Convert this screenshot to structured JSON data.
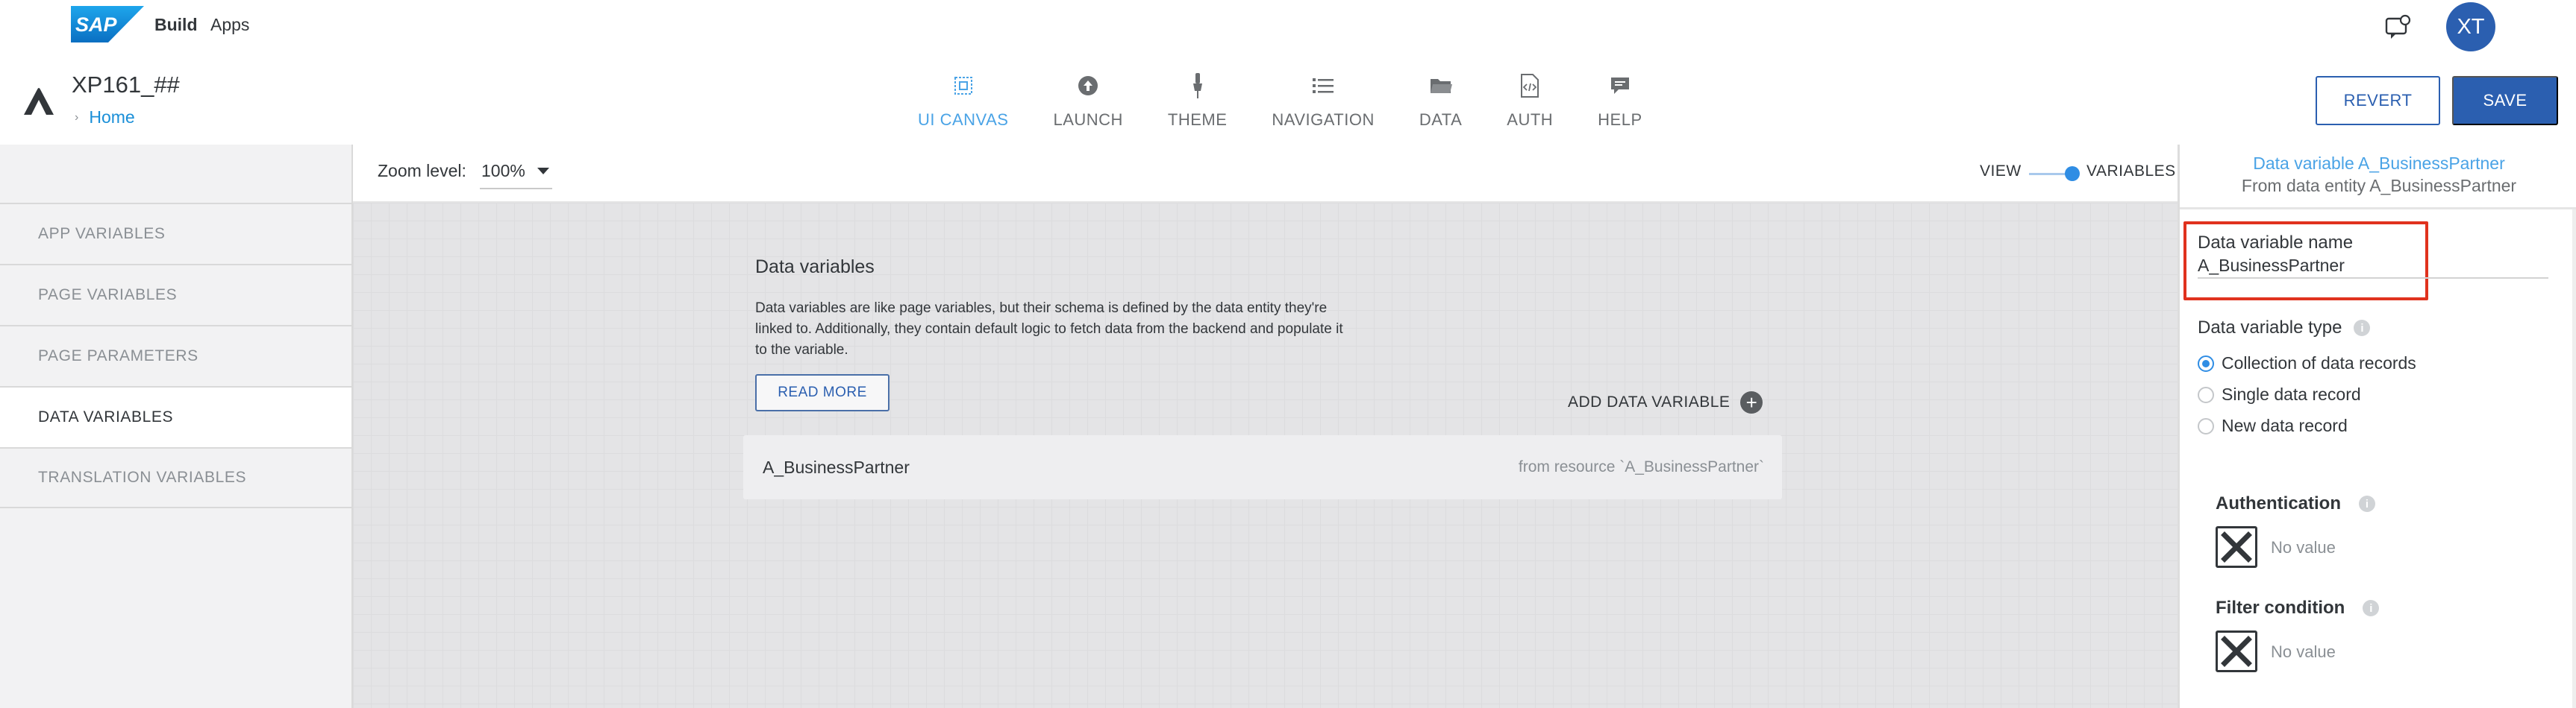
{
  "shell": {
    "logo": "SAP",
    "product_bold": "Build",
    "product_suffix": "Apps",
    "avatar_initials": "XT",
    "feedback_icon": "feedback-icon"
  },
  "app": {
    "title": "XP161_##",
    "breadcrumb": "Home"
  },
  "nav": {
    "tabs": [
      {
        "label": "UI CANVAS",
        "icon": "canvas-icon",
        "active": true
      },
      {
        "label": "LAUNCH",
        "icon": "upload-icon",
        "active": false
      },
      {
        "label": "THEME",
        "icon": "brush-icon",
        "active": false
      },
      {
        "label": "NAVIGATION",
        "icon": "list-icon",
        "active": false
      },
      {
        "label": "DATA",
        "icon": "folder-icon",
        "active": false
      },
      {
        "label": "AUTH",
        "icon": "code-file-icon",
        "active": false
      },
      {
        "label": "HELP",
        "icon": "chat-icon",
        "active": false
      }
    ],
    "accent_color": "#4aa3e6"
  },
  "actions": {
    "revert": "REVERT",
    "save": "SAVE"
  },
  "sidebar": {
    "items": [
      {
        "label": "APP VARIABLES",
        "active": false
      },
      {
        "label": "PAGE VARIABLES",
        "active": false
      },
      {
        "label": "PAGE PARAMETERS",
        "active": false
      },
      {
        "label": "DATA VARIABLES",
        "active": true
      },
      {
        "label": "TRANSLATION VARIABLES",
        "active": false
      }
    ]
  },
  "toolbar": {
    "zoom_label": "Zoom level:",
    "zoom_value": "100%",
    "view_label": "VIEW",
    "variables_label": "VARIABLES",
    "toggle_state": "variables"
  },
  "canvas": {
    "title": "Data variables",
    "description": "Data variables are like page variables, but their schema is defined by the data entity they're linked to. Additionally, they contain default logic to fetch data from the backend and populate it to the variable.",
    "read_more": "READ MORE",
    "add_label": "ADD DATA VARIABLE",
    "rows": [
      {
        "name": "A_BusinessPartner",
        "source": "from resource `A_BusinessPartner`"
      }
    ]
  },
  "panel": {
    "title": "Data variable A_BusinessPartner",
    "subtitle": "From data entity A_BusinessPartner",
    "name_label": "Data variable name",
    "name_value": "A_BusinessPartner",
    "type_label": "Data variable type",
    "type_options": [
      {
        "label": "Collection of data records",
        "checked": true
      },
      {
        "label": "Single data record",
        "checked": false
      },
      {
        "label": "New data record",
        "checked": false
      }
    ],
    "authentication_label": "Authentication",
    "authentication_value": "No value",
    "filter_label": "Filter condition",
    "filter_value": "No value",
    "highlight_color": "#e0321e"
  }
}
